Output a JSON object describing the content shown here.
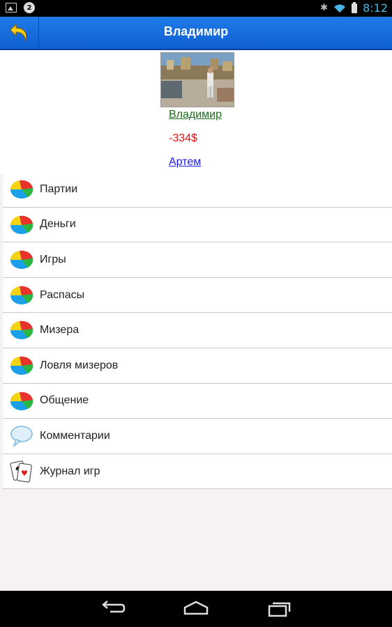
{
  "status_bar": {
    "notification_count": "2",
    "time": "8:12",
    "icons": [
      "image-icon",
      "bluetooth-icon",
      "wifi-icon",
      "battery-icon"
    ]
  },
  "action_bar": {
    "title": "Владимир",
    "back_icon": "back-arrow-icon",
    "accent_color": "#1a6fe0"
  },
  "profile": {
    "name_link": "Владимир",
    "balance": "-334$",
    "friend_link": "Артем"
  },
  "menu": {
    "items": [
      {
        "label": "Партии",
        "icon": "pie-chart-icon"
      },
      {
        "label": "Деньги",
        "icon": "pie-chart-icon"
      },
      {
        "label": "Игры",
        "icon": "pie-chart-icon"
      },
      {
        "label": "Распасы",
        "icon": "pie-chart-icon"
      },
      {
        "label": "Мизера",
        "icon": "pie-chart-icon"
      },
      {
        "label": "Ловля мизеров",
        "icon": "pie-chart-icon"
      },
      {
        "label": "Общение",
        "icon": "pie-chart-icon"
      },
      {
        "label": "Комментарии",
        "icon": "speech-bubble-icon"
      },
      {
        "label": "Журнал игр",
        "icon": "playing-cards-icon"
      }
    ]
  },
  "nav_bar": {
    "buttons": [
      "back-nav-icon",
      "home-nav-icon",
      "recent-apps-icon"
    ]
  }
}
